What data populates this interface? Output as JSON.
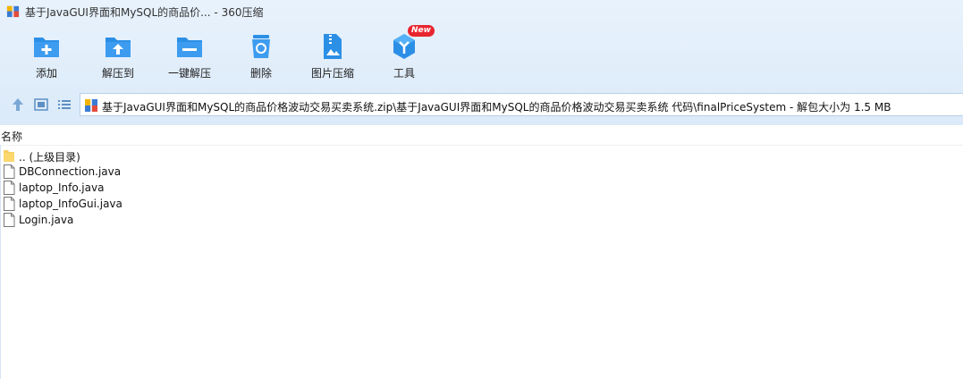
{
  "window": {
    "title": "基于JavaGUI界面和MySQL的商品价... - 360压缩"
  },
  "toolbar": {
    "items": [
      {
        "label": "添加",
        "icon": "add-folder-icon"
      },
      {
        "label": "解压到",
        "icon": "extract-to-icon"
      },
      {
        "label": "一键解压",
        "icon": "one-click-extract-icon"
      },
      {
        "label": "删除",
        "icon": "recycle-delete-icon"
      },
      {
        "label": "图片压缩",
        "icon": "image-compress-icon"
      },
      {
        "label": "工具",
        "icon": "tools-icon",
        "badge": "New"
      }
    ]
  },
  "nav": {
    "path": "基于JavaGUI界面和MySQL的商品价格波动交易买卖系统.zip\\基于JavaGUI界面和MySQL的商品价格波动交易买卖系统 代码\\finalPriceSystem - 解包大小为 1.5 MB"
  },
  "list": {
    "header_name": "名称",
    "files": [
      {
        "name": ".. (上级目录)",
        "type": "folder"
      },
      {
        "name": "DBConnection.java",
        "type": "file"
      },
      {
        "name": "laptop_Info.java",
        "type": "file"
      },
      {
        "name": "laptop_InfoGui.java",
        "type": "file"
      },
      {
        "name": "Login.java",
        "type": "file"
      }
    ]
  },
  "colors": {
    "accent": "#2c8fe6",
    "badge": "#e8252e",
    "folder": "#f7cf62"
  }
}
